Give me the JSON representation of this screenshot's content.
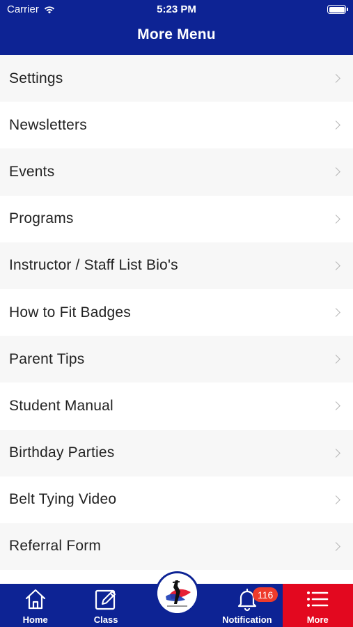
{
  "status_bar": {
    "carrier": "Carrier",
    "time": "5:23 PM"
  },
  "header": {
    "title": "More Menu"
  },
  "menu": {
    "items": [
      {
        "label": "Settings"
      },
      {
        "label": "Newsletters"
      },
      {
        "label": "Events"
      },
      {
        "label": "Programs"
      },
      {
        "label": "Instructor / Staff List Bio's"
      },
      {
        "label": "How to Fit Badges"
      },
      {
        "label": "Parent Tips"
      },
      {
        "label": "Student Manual"
      },
      {
        "label": "Birthday Parties"
      },
      {
        "label": "Belt Tying Video"
      },
      {
        "label": "Referral Form"
      }
    ]
  },
  "tabbar": {
    "tabs": [
      {
        "label": "Home",
        "icon": "home-icon"
      },
      {
        "label": "Class",
        "icon": "edit-icon"
      },
      {
        "label": "",
        "icon": "school-logo"
      },
      {
        "label": "Notification",
        "icon": "bell-icon",
        "badge": "116"
      },
      {
        "label": "More",
        "icon": "menu-list-icon",
        "active": true
      }
    ]
  },
  "colors": {
    "primary": "#0d2394",
    "active_tab": "#e3081f",
    "badge": "#ee3b2b",
    "row_alt": "#f7f7f7"
  }
}
